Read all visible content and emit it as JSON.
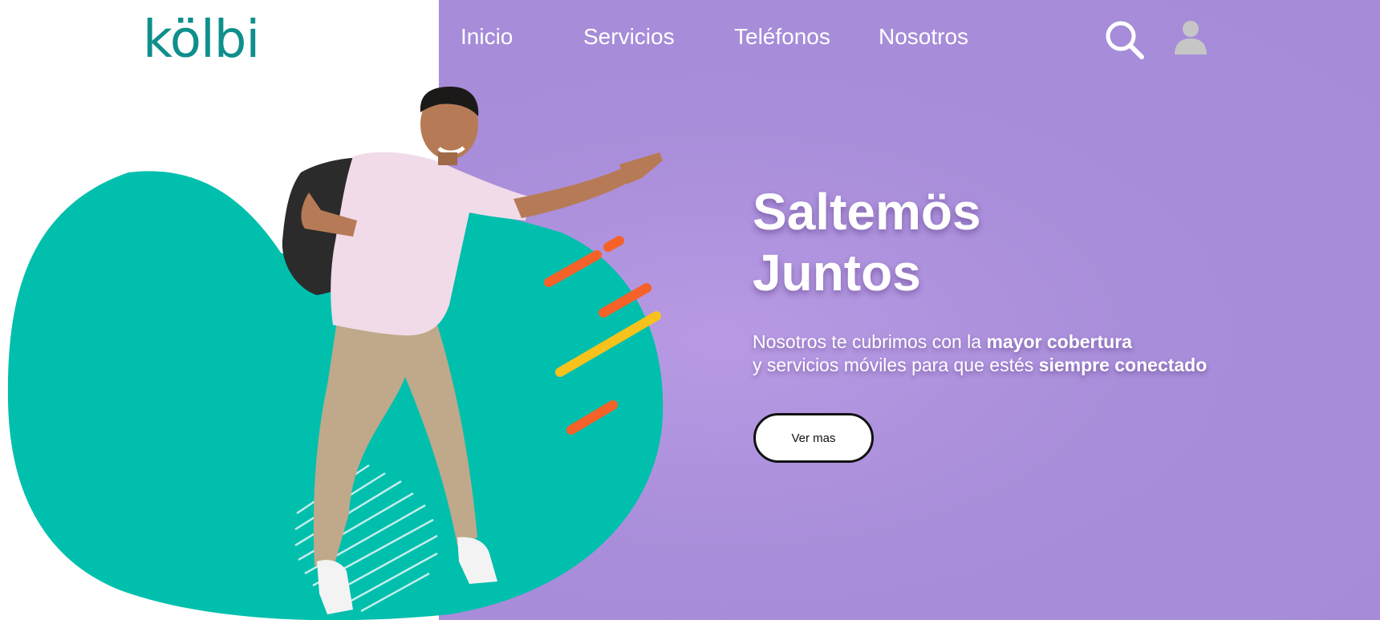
{
  "brand": {
    "logo_text": "kölbi",
    "logo_color": "#0f8f8c",
    "logo_dot_color": "#d8264f"
  },
  "nav": {
    "items": [
      {
        "label": "Inicio"
      },
      {
        "label": "Servicios"
      },
      {
        "label": "Teléfonos"
      },
      {
        "label": "Nosotros"
      }
    ],
    "search_icon": "search-icon",
    "user_icon": "user-icon"
  },
  "hero": {
    "title_line1": "Saltemös",
    "title_line2": "Juntos",
    "subtitle_line1_regular": "Nosotros te cubrimos con la ",
    "subtitle_line1_bold": "mayor cobertura",
    "subtitle_line2_regular": "y servicios móviles para que  estés ",
    "subtitle_line2_bold": "siempre conectado",
    "cta_label": "Ver mas"
  },
  "colors": {
    "purple_background": "#a88dda",
    "teal_blob": "#00bfad",
    "orange_accent": "#f4622a",
    "yellow_accent": "#f7c21c"
  }
}
